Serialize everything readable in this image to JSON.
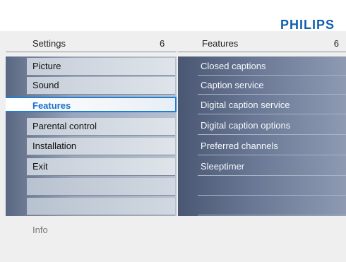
{
  "brand": {
    "name": "PHILIPS"
  },
  "header": {
    "left_title": "Settings",
    "left_count": "6",
    "right_title": "Features",
    "right_count": "6"
  },
  "left_menu": {
    "items": [
      {
        "label": "Picture",
        "selected": false
      },
      {
        "label": "Sound",
        "selected": false
      },
      {
        "label": "Features",
        "selected": true
      },
      {
        "label": "Parental control",
        "selected": false
      },
      {
        "label": "Installation",
        "selected": false
      },
      {
        "label": "Exit",
        "selected": false
      }
    ]
  },
  "right_menu": {
    "items": [
      {
        "label": "Closed captions"
      },
      {
        "label": "Caption service"
      },
      {
        "label": "Digital caption service"
      },
      {
        "label": "Digital caption options"
      },
      {
        "label": "Preferred channels"
      },
      {
        "label": "Sleeptimer"
      }
    ]
  },
  "footer": {
    "info": "Info"
  },
  "colors": {
    "accent": "#1f7fd7",
    "brand": "#0f5fb0",
    "panel_dark": "#4a5773"
  }
}
